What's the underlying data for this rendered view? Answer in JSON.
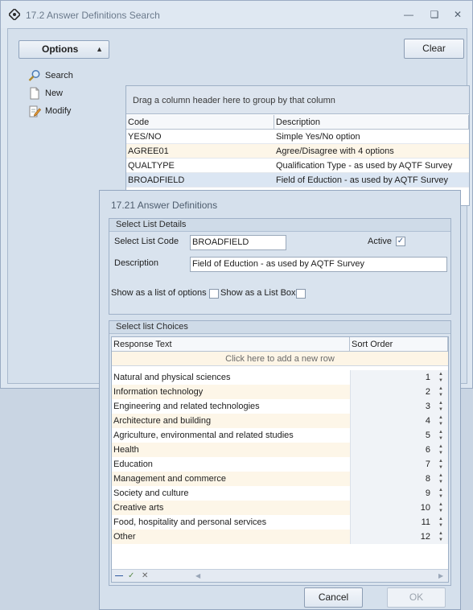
{
  "outer_window": {
    "title": "17.2 Answer Definitions Search",
    "clear_label": "Clear",
    "options": {
      "header": "Options",
      "items": [
        {
          "label": "Search",
          "icon": "search-icon"
        },
        {
          "label": "New",
          "icon": "new-document-icon"
        },
        {
          "label": "Modify",
          "icon": "edit-icon"
        }
      ]
    },
    "grid": {
      "group_hint": "Drag a column header here to group by that column",
      "columns": [
        "Code",
        "Description"
      ],
      "rows": [
        {
          "code": "YES/NO",
          "description": "Simple Yes/No option"
        },
        {
          "code": "AGREE01",
          "description": "Agree/Disagree with 4 options"
        },
        {
          "code": "QUALTYPE",
          "description": "Qualification Type - as used by AQTF Survey"
        },
        {
          "code": "BROADFIELD",
          "description": "Field of Eduction - as used by AQTF Survey"
        }
      ]
    }
  },
  "dialog": {
    "title": "17.21 Answer Definitions",
    "details": {
      "caption": "Select List Details",
      "code_label": "Select List Code",
      "code_value": "BROADFIELD",
      "active_label": "Active",
      "active_checked": true,
      "description_label": "Description",
      "description_value": "Field of Eduction - as used by AQTF Survey",
      "options_label": "Show as a list of options",
      "listbox_label": "Show as a List Box"
    },
    "choices": {
      "caption": "Select list Choices",
      "columns": [
        "Response Text",
        "Sort Order"
      ],
      "new_row_hint": "Click here to add a new row",
      "rows": [
        {
          "text": "Natural and physical sciences",
          "order": "1"
        },
        {
          "text": "Information technology",
          "order": "2"
        },
        {
          "text": "Engineering and related technologies",
          "order": "3"
        },
        {
          "text": "Architecture and building",
          "order": "4"
        },
        {
          "text": "Agriculture, environmental and related studies",
          "order": "5"
        },
        {
          "text": "Health",
          "order": "6"
        },
        {
          "text": "Education",
          "order": "7"
        },
        {
          "text": "Management and commerce",
          "order": "8"
        },
        {
          "text": "Society and culture",
          "order": "9"
        },
        {
          "text": "Creative arts",
          "order": "10"
        },
        {
          "text": "Food, hospitality and personal services",
          "order": "11"
        },
        {
          "text": "Other",
          "order": "12"
        }
      ]
    },
    "cancel_label": "Cancel",
    "ok_label": "OK"
  },
  "colors": {
    "window_bg": "#d5e0ec",
    "row_alt": "#fdf6e8",
    "accent": "#2f5aa0"
  }
}
